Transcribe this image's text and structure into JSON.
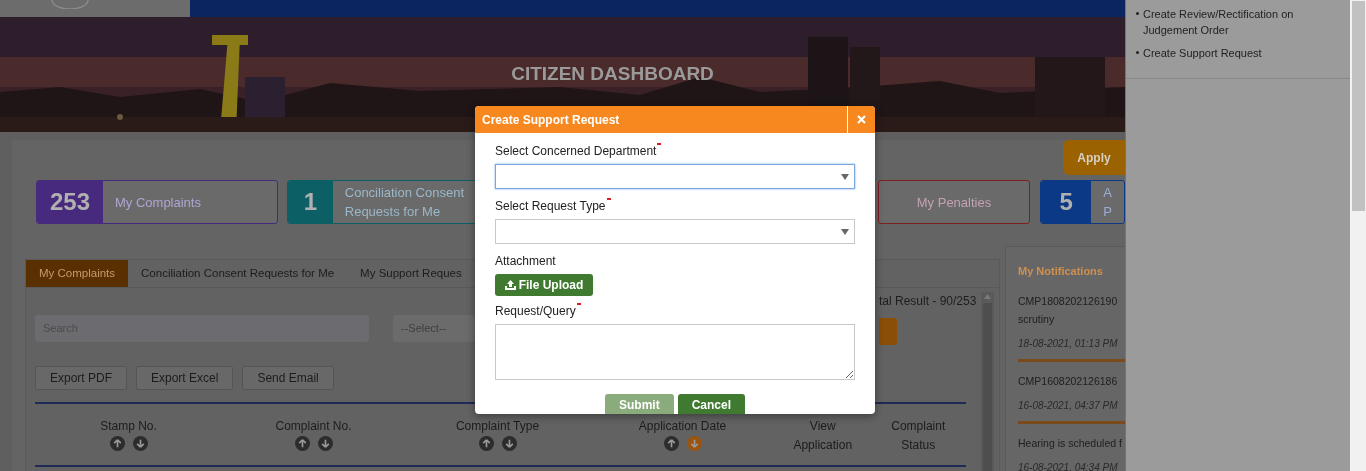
{
  "hero": {
    "title": "CITIZEN DASHBOARD"
  },
  "apply_button": "Apply",
  "stats": [
    {
      "count": "253",
      "label_lines": [
        "My Complaints"
      ],
      "color": "#47297e"
    },
    {
      "count": "1",
      "label_lines": [
        "Conciliation Consent",
        "Requests for Me"
      ],
      "color": "#0d5f66"
    },
    {
      "label_lines": [
        "My Penalties"
      ],
      "color": "#7f1f22"
    },
    {
      "count": "5",
      "label_lines": [
        "A",
        "P"
      ],
      "color": "#0b3985"
    }
  ],
  "tabs": [
    {
      "label": "My Complaints",
      "selected": true
    },
    {
      "label": "Conciliation Consent Requests for Me",
      "selected": false
    },
    {
      "label": "My Support Reques",
      "selected": false
    }
  ],
  "search": {
    "placeholder": "Search"
  },
  "filter": {
    "placeholder": "--Select--"
  },
  "result_text": "tal Result - 90/253",
  "export_buttons": [
    "Export PDF",
    "Export Excel",
    "Send Email"
  ],
  "table": {
    "columns": [
      {
        "label": "Stamp No.",
        "sorted_descending": false
      },
      {
        "label": "Complaint No.",
        "sorted_descending": false
      },
      {
        "label": "Complaint Type",
        "sorted_descending": false
      },
      {
        "label": "Application Date",
        "sorted_descending": true
      },
      {
        "label": "View Application"
      },
      {
        "label": "Complaint Status"
      }
    ]
  },
  "notifications": {
    "title": "My Notifications",
    "items": [
      {
        "lines": [
          "CMP1808202126190",
          "scrutiny"
        ],
        "date": "18-08-2021, 01:13 PM"
      },
      {
        "lines": [
          "CMP1608202126186"
        ],
        "date": "16-08-2021, 04:37 PM"
      },
      {
        "lines": [
          "Hearing is scheduled f"
        ],
        "date": "16-08-2021, 04:34 PM"
      }
    ]
  },
  "side_menu": {
    "items": [
      "Create Review/Rectification on Judgement Order",
      "Create Support Request"
    ]
  },
  "modal": {
    "title": "Create Support Request",
    "fields": [
      {
        "kind": "select",
        "label": "Select Concerned Department",
        "required": true,
        "focused": true
      },
      {
        "kind": "select",
        "label": "Select Request Type",
        "required": true,
        "focused": false
      },
      {
        "kind": "upload",
        "label": "Attachment",
        "required": false,
        "button": "File Upload"
      },
      {
        "kind": "textarea",
        "label": "Request/Query",
        "required": true
      }
    ],
    "buttons": [
      {
        "label": "Submit",
        "disabled": true
      },
      {
        "label": "Cancel",
        "disabled": false
      }
    ]
  }
}
